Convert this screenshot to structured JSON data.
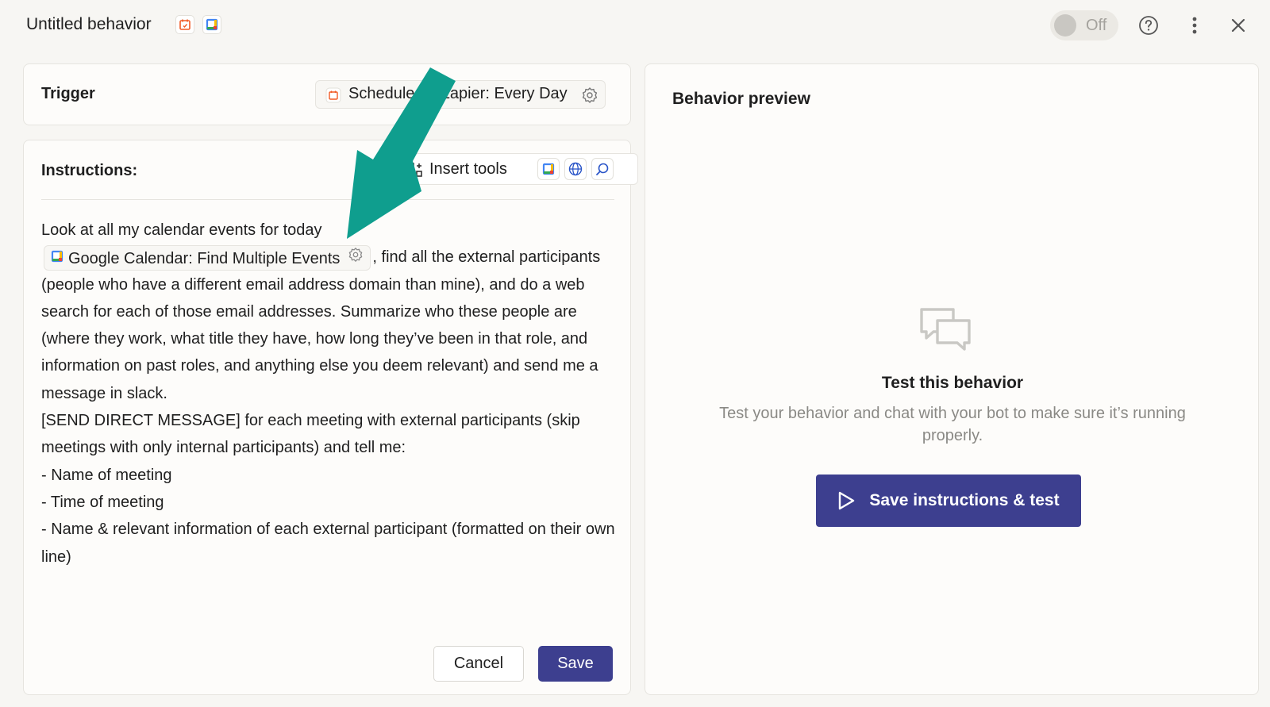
{
  "header": {
    "title": "Untitled behavior",
    "icons": [
      "schedule-icon",
      "google-calendar-icon"
    ],
    "toggle_label": "Off"
  },
  "trigger": {
    "label": "Trigger",
    "chip_text": "Schedule by Zapier: Every Day"
  },
  "instructions": {
    "label": "Instructions:",
    "insert_tools_label": "Insert tools",
    "tool_icons": [
      "google-calendar-icon",
      "web-globe-icon",
      "search-icon"
    ],
    "text_before_chip": "Look at all my calendar events for today",
    "chip_text": "Google Calendar: Find Multiple Events",
    "text_after_chip": ", find all the external participants (people who have a different email address domain than mine), and do a web search for each of those email addresses. Summarize who these people are (where they work, what title they have, how long they’ve been in that role, and information on past roles, and anything else you deem relevant) and send me a message in slack.",
    "line_send": "[SEND DIRECT MESSAGE] for each meeting with external participants (skip meetings with only internal participants) and tell me:",
    "bullets": [
      "- Name of meeting",
      "- Time of meeting",
      "- Name & relevant information of each external participant (formatted on their own line)"
    ],
    "cancel_label": "Cancel",
    "save_label": "Save"
  },
  "preview": {
    "title": "Behavior preview",
    "empty_title": "Test this behavior",
    "empty_desc": "Test your behavior and chat with your bot to make sure it’s running properly.",
    "button_label": "Save instructions & test"
  },
  "colors": {
    "accent": "#3d3f8f",
    "arrow": "#0f9e8e",
    "background": "#f7f6f3",
    "schedule_orange": "#f15a24"
  }
}
